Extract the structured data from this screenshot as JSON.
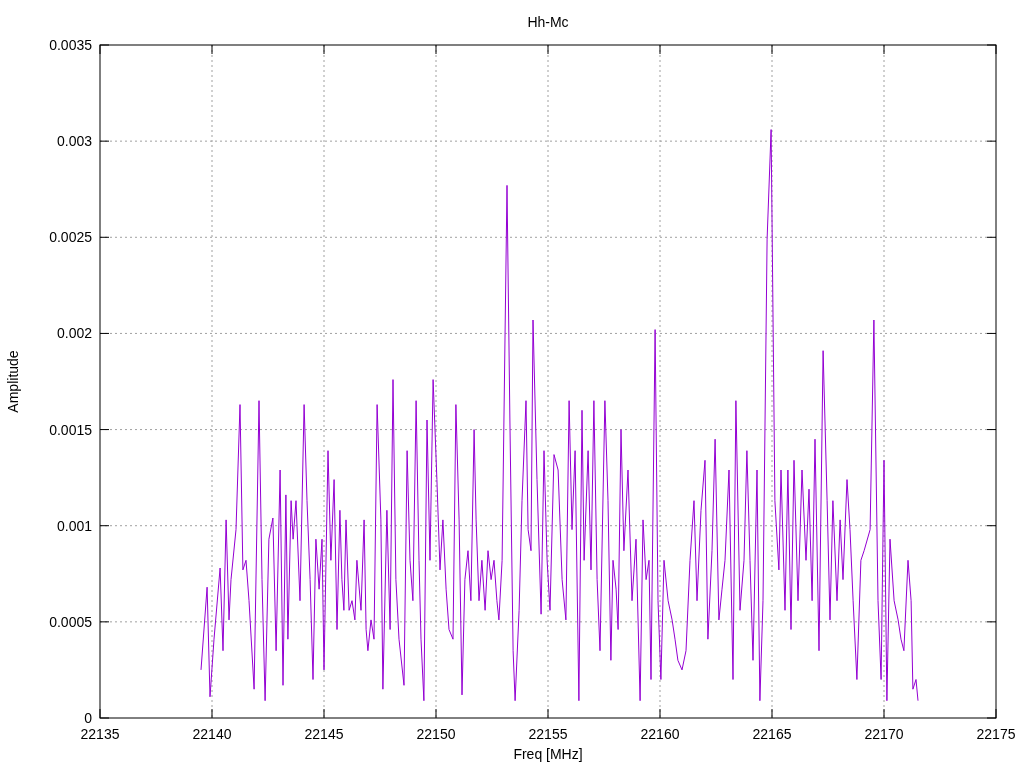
{
  "chart_data": {
    "type": "line",
    "title": "Hh-Mc",
    "xlabel": "Freq [MHz]",
    "ylabel": "Amplitude",
    "xlim": [
      22135,
      22175
    ],
    "grid": true,
    "ylim": [
      0,
      0.0035
    ],
    "xticks": [
      22135,
      22140,
      22145,
      22150,
      22155,
      22160,
      22165,
      22170,
      22175
    ],
    "yticks": [
      0,
      0.0005,
      0.001,
      0.0015,
      0.002,
      0.0025,
      0.003,
      0.0035
    ],
    "x": [
      22139.51,
      22139.78,
      22139.91,
      22140.09,
      22140.36,
      22140.49,
      22140.63,
      22140.76,
      22140.85,
      22141.07,
      22141.25,
      22141.38,
      22141.52,
      22141.65,
      22141.88,
      22142.1,
      22142.23,
      22142.37,
      22142.54,
      22142.72,
      22142.86,
      22143.04,
      22143.17,
      22143.3,
      22143.39,
      22143.53,
      22143.62,
      22143.75,
      22143.93,
      22144.11,
      22144.24,
      22144.38,
      22144.51,
      22144.64,
      22144.78,
      22144.91,
      22145.0,
      22145.18,
      22145.31,
      22145.45,
      22145.58,
      22145.71,
      22145.8,
      22145.89,
      22145.98,
      22146.12,
      22146.25,
      22146.38,
      22146.47,
      22146.65,
      22146.79,
      22146.88,
      22146.96,
      22147.1,
      22147.23,
      22147.37,
      22147.54,
      22147.63,
      22147.81,
      22147.95,
      22148.08,
      22148.21,
      22148.35,
      22148.57,
      22148.71,
      22148.84,
      22148.97,
      22149.11,
      22149.24,
      22149.33,
      22149.46,
      22149.6,
      22149.73,
      22149.87,
      22150.04,
      22150.18,
      22150.31,
      22150.45,
      22150.58,
      22150.76,
      22150.89,
      22151.03,
      22151.16,
      22151.29,
      22151.43,
      22151.56,
      22151.7,
      22151.79,
      22151.92,
      22152.05,
      22152.19,
      22152.32,
      22152.46,
      22152.59,
      22152.72,
      22152.81,
      22152.95,
      22153.17,
      22153.3,
      22153.44,
      22153.53,
      22153.71,
      22153.84,
      22154.02,
      22154.11,
      22154.24,
      22154.33,
      22154.51,
      22154.69,
      22154.82,
      22154.96,
      22155.09,
      22155.27,
      22155.45,
      22155.63,
      22155.8,
      22155.94,
      22156.07,
      22156.21,
      22156.38,
      22156.52,
      22156.61,
      22156.79,
      22156.92,
      22157.05,
      22157.19,
      22157.32,
      22157.54,
      22157.68,
      22157.81,
      22157.9,
      22158.04,
      22158.13,
      22158.26,
      22158.39,
      22158.57,
      22158.75,
      22158.93,
      22159.11,
      22159.24,
      22159.38,
      22159.51,
      22159.6,
      22159.78,
      22159.91,
      22160.04,
      22160.18,
      22160.36,
      22160.54,
      22160.67,
      22160.8,
      22160.98,
      22161.16,
      22161.34,
      22161.52,
      22161.65,
      22161.83,
      22162.01,
      22162.14,
      22162.32,
      22162.46,
      22162.63,
      22162.77,
      22162.9,
      22163.08,
      22163.26,
      22163.39,
      22163.57,
      22163.75,
      22163.88,
      22164.02,
      22164.15,
      22164.33,
      22164.46,
      22164.6,
      22164.78,
      22164.96,
      22165.13,
      22165.31,
      22165.4,
      22165.58,
      22165.71,
      22165.85,
      22165.98,
      22166.16,
      22166.34,
      22166.52,
      22166.65,
      22166.79,
      22166.92,
      22167.1,
      22167.28,
      22167.46,
      22167.59,
      22167.72,
      22167.9,
      22168.04,
      22168.17,
      22168.35,
      22168.48,
      22168.62,
      22168.79,
      22168.97,
      22169.11,
      22169.38,
      22169.55,
      22169.73,
      22169.87,
      22170.0,
      22170.13,
      22170.27,
      22170.45,
      22170.63,
      22170.76,
      22170.89,
      22171.07,
      22171.21,
      22171.29,
      22171.43,
      22171.52
    ],
    "series": [
      {
        "color": "#9400d3",
        "values": [
          0.00025,
          0.00068,
          0.00011,
          0.00041,
          0.00078,
          0.00035,
          0.00103,
          0.00051,
          0.00072,
          0.00098,
          0.00163,
          0.00077,
          0.00082,
          0.00061,
          0.00015,
          0.00165,
          0.00072,
          9e-05,
          0.00093,
          0.00104,
          0.00035,
          0.00129,
          0.00017,
          0.00116,
          0.00041,
          0.00113,
          0.00093,
          0.00113,
          0.00061,
          0.00163,
          0.00113,
          0.00072,
          0.0002,
          0.00093,
          0.00067,
          0.00093,
          0.00025,
          0.00139,
          0.00082,
          0.00124,
          0.00046,
          0.00108,
          0.00072,
          0.00056,
          0.00103,
          0.00056,
          0.00061,
          0.00051,
          0.00082,
          0.00056,
          0.00103,
          0.00046,
          0.00035,
          0.00051,
          0.00041,
          0.00163,
          0.00103,
          0.00015,
          0.00108,
          0.00046,
          0.00176,
          0.00072,
          0.00041,
          0.00017,
          0.00139,
          0.00082,
          0.00061,
          0.00165,
          0.00082,
          0.00041,
          9e-05,
          0.00155,
          0.00082,
          0.00176,
          0.00124,
          0.00077,
          0.00103,
          0.00067,
          0.00046,
          0.00041,
          0.00163,
          0.00103,
          0.00012,
          0.00072,
          0.00087,
          0.00061,
          0.0015,
          0.00103,
          0.00061,
          0.00082,
          0.00056,
          0.00087,
          0.00072,
          0.00082,
          0.00061,
          0.00051,
          0.00082,
          0.00277,
          0.00155,
          0.00035,
          9e-05,
          0.00056,
          0.00113,
          0.00165,
          0.00098,
          0.00087,
          0.00207,
          0.00124,
          0.00054,
          0.00139,
          0.00082,
          0.00056,
          0.00137,
          0.00129,
          0.00072,
          0.00051,
          0.00165,
          0.00098,
          0.00139,
          9e-05,
          0.0016,
          0.00082,
          0.00139,
          0.00077,
          0.00165,
          0.00072,
          0.00035,
          0.00165,
          0.00113,
          0.0003,
          0.00082,
          0.00067,
          0.00046,
          0.0015,
          0.00087,
          0.00129,
          0.00061,
          0.00093,
          9e-05,
          0.00103,
          0.00072,
          0.00082,
          0.0002,
          0.00202,
          0.00061,
          0.0002,
          0.00082,
          0.00061,
          0.00051,
          0.00041,
          0.0003,
          0.00025,
          0.00035,
          0.00082,
          0.00113,
          0.00061,
          0.00108,
          0.00134,
          0.00041,
          0.00087,
          0.00145,
          0.00051,
          0.00067,
          0.00082,
          0.00129,
          0.0002,
          0.00165,
          0.00056,
          0.00082,
          0.00139,
          0.00082,
          0.0003,
          0.00129,
          9e-05,
          0.00061,
          0.00249,
          0.00306,
          0.00113,
          0.00077,
          0.00129,
          0.00056,
          0.00129,
          0.00046,
          0.00134,
          0.00061,
          0.00129,
          0.00082,
          0.00119,
          0.00061,
          0.00145,
          0.00035,
          0.00191,
          0.00113,
          0.00051,
          0.00113,
          0.00061,
          0.00103,
          0.00072,
          0.00124,
          0.00098,
          0.00061,
          0.0002,
          0.00082,
          0.00087,
          0.00098,
          0.00207,
          0.00061,
          0.0002,
          0.00134,
          9e-05,
          0.00093,
          0.00061,
          0.00051,
          0.00041,
          0.00035,
          0.00082,
          0.00061,
          0.00015,
          0.0002,
          9e-05
        ]
      }
    ]
  }
}
